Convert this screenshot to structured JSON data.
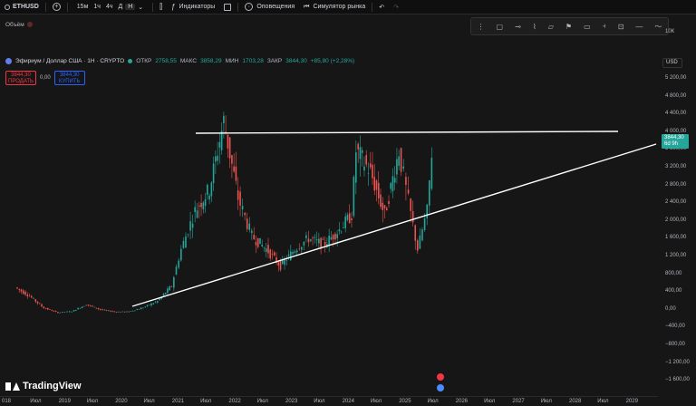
{
  "toolbar": {
    "symbol": "ETHUSD",
    "timeframes": [
      "15м",
      "1ч",
      "4ч",
      "Д",
      "Н"
    ],
    "active_timeframe": "Н",
    "indicators": "Индикаторы",
    "alerts": "Оповещения",
    "replay": "Симулятор рынка",
    "undo_icon": "undo-icon",
    "redo_icon": "redo-icon"
  },
  "pane": {
    "volume_label": "Объём"
  },
  "legend": {
    "title": "Эфириум / Доллар США · 1Н · CRYPTO",
    "open_label": "ОТКР",
    "open_value": "2758,55",
    "high_label": "МАКС",
    "high_value": "3858,29",
    "low_label": "МИН",
    "low_value": "1703,28",
    "close_label": "ЗАКР",
    "close_value": "3844,30",
    "change": "+85,80 (+2,28%)"
  },
  "trade": {
    "sell_price": "3844,30",
    "sell_label": "ПРОДАТЬ",
    "spread": "0,00",
    "buy_price": "3844,30",
    "buy_label": "КУПИТЬ"
  },
  "price_axis": {
    "currency": "USD",
    "top_label": "10К",
    "labels": [
      "5 200,00",
      "4 800,00",
      "4 400,00",
      "4 000,00",
      "3 600,00",
      "3 200,00",
      "2 800,00",
      "2 400,00",
      "2 000,00",
      "1 600,00",
      "1 200,00",
      "800,00",
      "400,00",
      "0,00",
      "−400,00",
      "−800,00",
      "−1 200,00",
      "−1 600,00"
    ],
    "last_price": "3844,30",
    "countdown": "6d 9h"
  },
  "time_axis": {
    "labels": [
      "018",
      "Июл",
      "2019",
      "Июл",
      "2020",
      "Июл",
      "2021",
      "Июл",
      "2022",
      "Июл",
      "2023",
      "Июл",
      "2024",
      "Июл",
      "2025",
      "Июл",
      "2026",
      "Июл",
      "2027",
      "Июл",
      "2028",
      "Июл",
      "2029"
    ]
  },
  "branding": {
    "logo_text": "TradingView"
  },
  "colors": {
    "up": "#26a69a",
    "down": "#ef5350",
    "accent": "#2962ff",
    "background": "#161616"
  },
  "chart_data": {
    "type": "candlestick",
    "series": [
      {
        "name": "Эфириум / Доллар США",
        "x": [
          "2018-03",
          "2018-06",
          "2018-09",
          "2018-12",
          "2019-03",
          "2019-06",
          "2019-09",
          "2019-12",
          "2020-03",
          "2020-06",
          "2020-09",
          "2020-12",
          "2021-02",
          "2021-05",
          "2021-08",
          "2021-11",
          "2022-02",
          "2022-05",
          "2022-08",
          "2022-11",
          "2023-02",
          "2023-05",
          "2023-08",
          "2023-11",
          "2024-02",
          "2024-03",
          "2024-06",
          "2024-09",
          "2024-12",
          "2025-02",
          "2025-04",
          "2025-06",
          "2025-07"
        ],
        "values": [
          700,
          500,
          220,
          110,
          140,
          300,
          180,
          130,
          130,
          230,
          380,
          740,
          1600,
          2500,
          3000,
          4600,
          2800,
          1900,
          1600,
          1200,
          1600,
          1850,
          1700,
          2000,
          2400,
          3900,
          3400,
          2400,
          3900,
          2700,
          1600,
          2500,
          3844
        ]
      }
    ],
    "annotations": [
      "horizontal resistance ~4 000",
      "ascending trendline from 2020 low"
    ],
    "ylim": [
      -1800,
      5500
    ],
    "grid": false,
    "legend": "top-left"
  }
}
